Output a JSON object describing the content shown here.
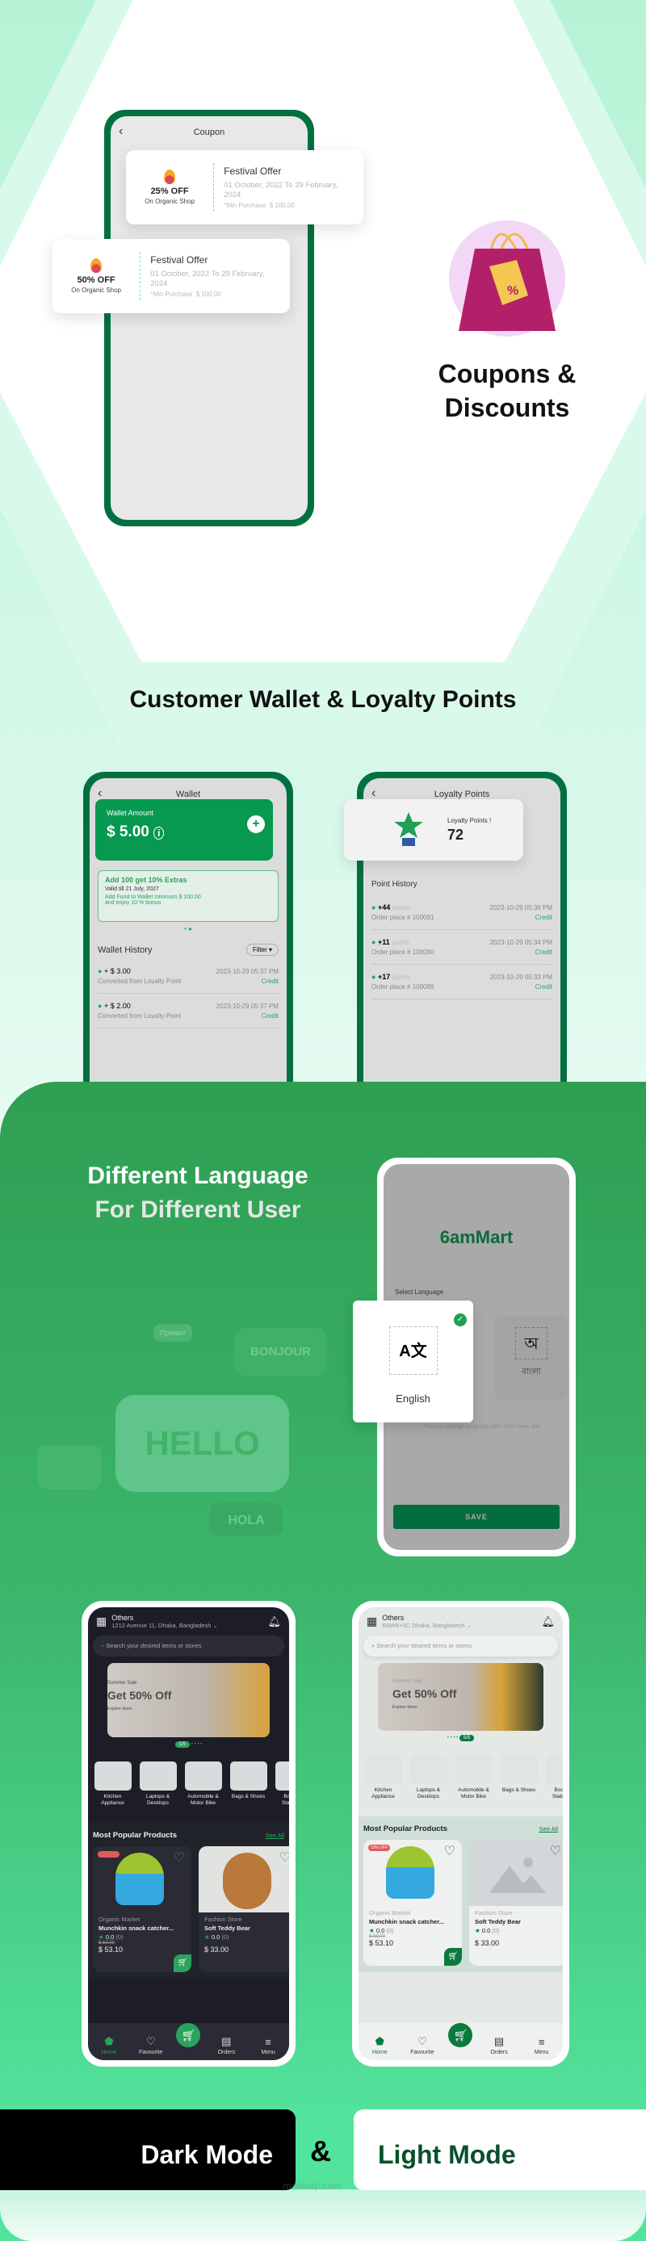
{
  "colors": {
    "brand_green": "#03703f",
    "accent_green": "#2aa35c",
    "mint": "#c9f7e2",
    "dark_bg": "#1c1d26",
    "light_bg": "#eef2f0"
  },
  "coupons": {
    "screen_title": "Coupon",
    "section_title_line1": "Coupons &",
    "section_title_line2": "Discounts",
    "cards": [
      {
        "discount": "25% OFF",
        "shop": "On Organic Shop",
        "title": "Festival Offer",
        "dates": "01 October, 2022 To 29 February, 2024",
        "min_label": "*Min Purchase",
        "min_value": "$ 100.00"
      },
      {
        "discount": "50% OFF",
        "shop": "On Organic Shop",
        "title": "Festival Offer",
        "dates": "01 October, 2022 To 29 February, 2024",
        "min_label": "*Min Purchase",
        "min_value": "$ 100.00"
      }
    ]
  },
  "wallet_section_title": "Customer Wallet & Loyalty Points",
  "wallet": {
    "title": "Wallet",
    "amount_label": "Wallet Amount",
    "amount": "$ 5.00",
    "promo": {
      "title": "Add 100 get 10% Extras",
      "valid": "Valid till 21 July, 2027",
      "desc": "Add Fund to Wallet minimum $ 100.00 and enjoy 10 % bonus"
    },
    "history_title": "Wallet History",
    "filter": "Filter",
    "items": [
      {
        "amount": "+ $ 3.00",
        "desc": "Converted from Loyalty Point",
        "date": "2023-10-29 05:37 PM",
        "type": "Credit"
      },
      {
        "amount": "+ $ 2.00",
        "desc": "Converted from Loyalty Point",
        "date": "2023-10-29 05:37 PM",
        "type": "Credit"
      }
    ]
  },
  "loyalty": {
    "title": "Loyalty Points",
    "label": "Loyalty Points !",
    "points": "72",
    "history_title": "Point History",
    "items": [
      {
        "points": "+44",
        "unit": "points",
        "order": "Order place # 100091",
        "date": "2023-10-29 05:36 PM",
        "type": "Credit"
      },
      {
        "points": "+11",
        "unit": "points",
        "order": "Order place # 100090",
        "date": "2023-10-29 05:34 PM",
        "type": "Credit"
      },
      {
        "points": "+17",
        "unit": "points",
        "order": "Order place # 100089",
        "date": "2023-10-29 05:33 PM",
        "type": "Credit"
      }
    ]
  },
  "language": {
    "title_line1": "Different Language",
    "title_line2": "For Different User",
    "illustration_words": [
      "Привет",
      "BONJOUR",
      "HELLO",
      "HOLA"
    ],
    "logo": "6amMart",
    "select_label": "Select Language",
    "options": [
      {
        "label": "English",
        "selected": true
      },
      {
        "label": "বাংলা",
        "selected": false
      }
    ],
    "hint": "You can change language later from menu bar",
    "save": "SAVE"
  },
  "home_dark": {
    "location_type": "Others",
    "address": "1212 Avenue 11, Dhaka, Bangladesh",
    "search_placeholder": "Search your desired items or stores",
    "banner": {
      "subtitle": "Summer Sale",
      "title": "Get 50% Off",
      "link": "Explore Items"
    },
    "page_indicator": "1/5"
  },
  "home_light": {
    "location_type": "Others",
    "address": "R9W8+5C Dhaka, Bangladesh",
    "search_placeholder": "Search your desired items or stores",
    "banner": {
      "subtitle": "Summer Sale",
      "title": "Get 50% Off",
      "link": "Explore Items"
    },
    "page_indicator": "5/5"
  },
  "home_common": {
    "categories": [
      "Kitchen Appliance",
      "Laptops & Desktops",
      "Automobile & Motor Bike",
      "Bags & Shoes",
      "Books & Stationery"
    ],
    "popular_title": "Most Popular Products",
    "see_all": "See All",
    "products": [
      {
        "store": "Organic Market",
        "name": "Munchkin snack catcher...",
        "rating": "0.0",
        "reviews": "(0)",
        "old_price": "$ 59.00",
        "price": "$ 53.10",
        "badge": "10% OFF"
      },
      {
        "store": "Fashion Store",
        "name": "Soft Teddy Bear",
        "rating": "0.0",
        "reviews": "(0)",
        "price": "$ 33.00"
      }
    ],
    "nav": [
      "Home",
      "Favourite",
      "Orders",
      "Menu"
    ]
  },
  "modes": {
    "dark": "Dark Mode",
    "amp": "&",
    "light": "Light Mode"
  },
  "watermark": "mostaql.com"
}
